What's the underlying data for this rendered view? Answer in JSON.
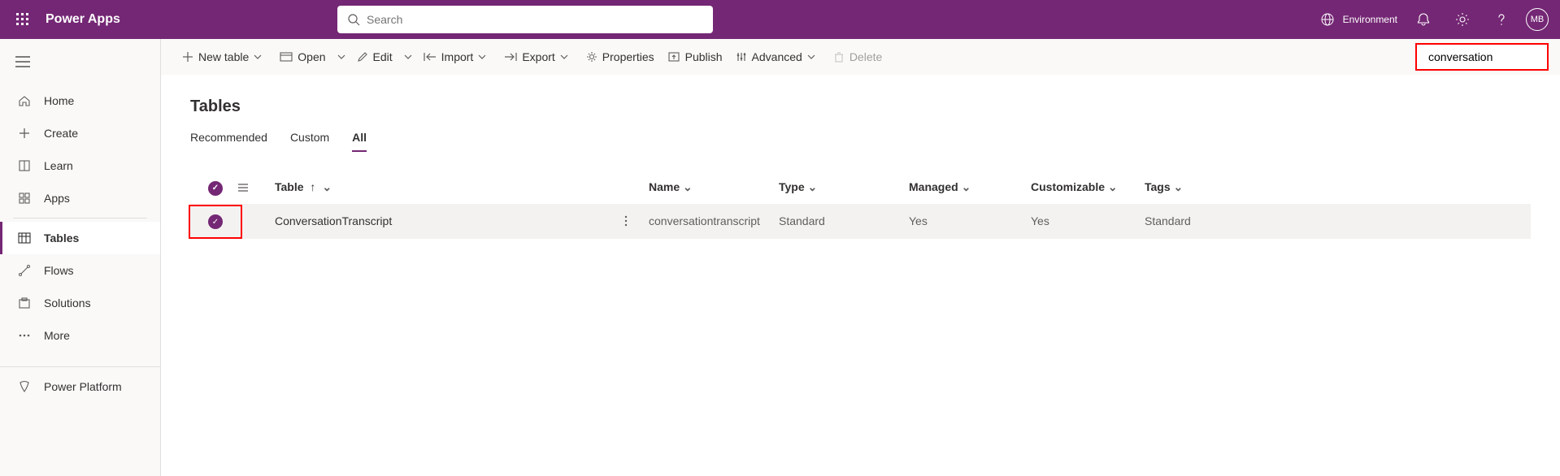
{
  "header": {
    "brand": "Power Apps",
    "search_placeholder": "Search",
    "environment_label": "Environment",
    "avatar_initials": "MB"
  },
  "sidebar": {
    "items": [
      {
        "label": "Home",
        "active": false
      },
      {
        "label": "Create",
        "active": false
      },
      {
        "label": "Learn",
        "active": false
      },
      {
        "label": "Apps",
        "active": false
      },
      {
        "label": "Tables",
        "active": true
      },
      {
        "label": "Flows",
        "active": false
      },
      {
        "label": "Solutions",
        "active": false
      },
      {
        "label": "More",
        "active": false
      }
    ],
    "footer_label": "Power Platform"
  },
  "commandbar": {
    "new_table": "New table",
    "open": "Open",
    "edit": "Edit",
    "import": "Import",
    "export": "Export",
    "properties": "Properties",
    "publish": "Publish",
    "advanced": "Advanced",
    "delete": "Delete",
    "filter_value": "conversation"
  },
  "page": {
    "title": "Tables",
    "tabs": {
      "recommended": "Recommended",
      "custom": "Custom",
      "all": "All"
    }
  },
  "table": {
    "columns": {
      "table": "Table",
      "name": "Name",
      "type": "Type",
      "managed": "Managed",
      "customizable": "Customizable",
      "tags": "Tags"
    },
    "row": {
      "table": "ConversationTranscript",
      "name": "conversationtranscript",
      "type": "Standard",
      "managed": "Yes",
      "customizable": "Yes",
      "tags": "Standard"
    }
  }
}
